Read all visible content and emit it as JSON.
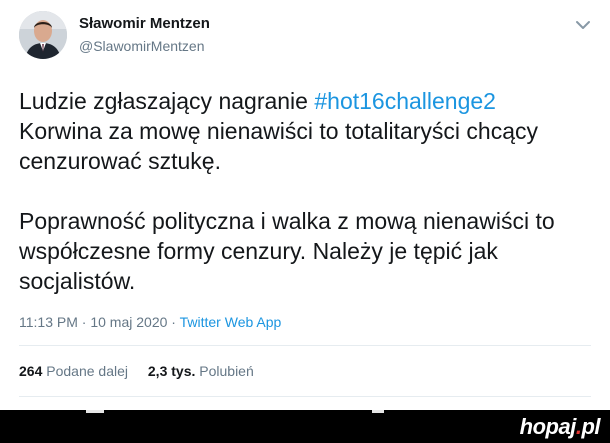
{
  "author": {
    "display_name": "Sławomir Mentzen",
    "handle": "@SlawomirMentzen",
    "avatar_icon": "user-avatar-icon"
  },
  "tweet": {
    "para1_before": "Ludzie zgłaszający nagranie ",
    "hashtag": "#hot16challenge2",
    "para1_after": " Korwina za mowę nienawiści to totalitaryści chcący cenzurować sztukę.",
    "para2": "Poprawność polityczna i walka z mową nienawiści to współczesne formy cenzury. Należy je tępić jak socjalistów.",
    "time": "11:13 PM",
    "separator": " · ",
    "date": "10 maj 2020",
    "source": "Twitter Web App"
  },
  "stats": {
    "retweets_count": "264",
    "retweets_label": "Podane dalej",
    "likes_count": "2,3 tys.",
    "likes_label": "Polubień"
  },
  "watermark": {
    "text": "hopaj",
    "dot": ".",
    "tld": "pl"
  },
  "colors": {
    "link": "#1b95e0",
    "text": "#14171a",
    "muted": "#657786"
  }
}
